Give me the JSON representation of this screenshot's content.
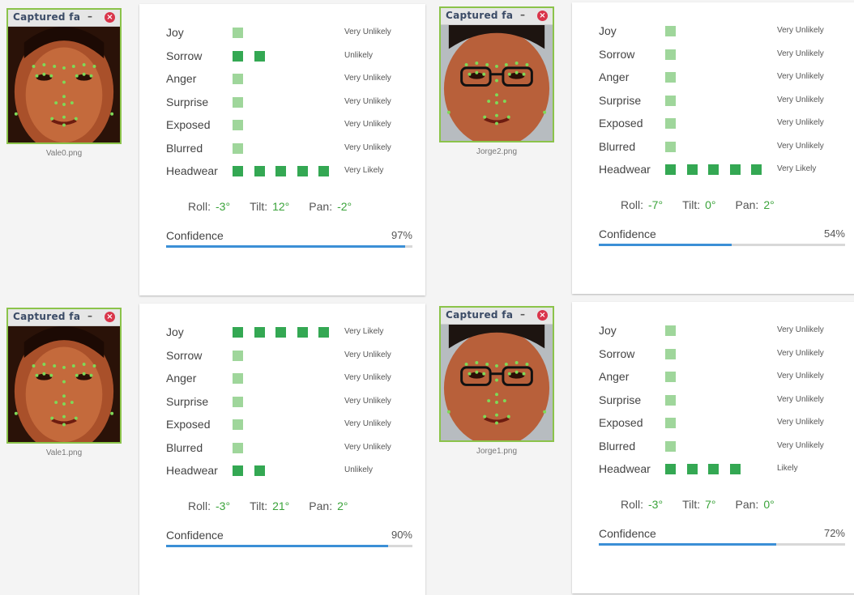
{
  "panels": [
    {
      "window_title": "Captured fa",
      "filename": "Vale0.png",
      "face_style": "female",
      "rows": [
        {
          "label": "Joy",
          "level": 1,
          "value": "Very Unlikely"
        },
        {
          "label": "Sorrow",
          "level": 2,
          "value": "Unlikely"
        },
        {
          "label": "Anger",
          "level": 1,
          "value": "Very Unlikely"
        },
        {
          "label": "Surprise",
          "level": 1,
          "value": "Very Unlikely"
        },
        {
          "label": "Exposed",
          "level": 1,
          "value": "Very Unlikely"
        },
        {
          "label": "Blurred",
          "level": 1,
          "value": "Very Unlikely"
        },
        {
          "label": "Headwear",
          "level": 5,
          "value": "Very Likely"
        }
      ],
      "roll_label": "Roll:",
      "roll": "-3°",
      "tilt_label": "Tilt:",
      "tilt": "12°",
      "pan_label": "Pan:",
      "pan": "-2°",
      "confidence_label": "Confidence",
      "confidence": "97%",
      "confidence_fraction": 0.97
    },
    {
      "window_title": "Captured fa",
      "filename": "Jorge2.png",
      "face_style": "male",
      "rows": [
        {
          "label": "Joy",
          "level": 1,
          "value": "Very Unlikely"
        },
        {
          "label": "Sorrow",
          "level": 1,
          "value": "Very Unlikely"
        },
        {
          "label": "Anger",
          "level": 1,
          "value": "Very Unlikely"
        },
        {
          "label": "Surprise",
          "level": 1,
          "value": "Very Unlikely"
        },
        {
          "label": "Exposed",
          "level": 1,
          "value": "Very Unlikely"
        },
        {
          "label": "Blurred",
          "level": 1,
          "value": "Very Unlikely"
        },
        {
          "label": "Headwear",
          "level": 5,
          "value": "Very Likely"
        }
      ],
      "roll_label": "Roll:",
      "roll": "-7°",
      "tilt_label": "Tilt:",
      "tilt": "0°",
      "pan_label": "Pan:",
      "pan": "2°",
      "confidence_label": "Confidence",
      "confidence": "54%",
      "confidence_fraction": 0.54
    },
    {
      "window_title": "Captured fa",
      "filename": "Vale1.png",
      "face_style": "female",
      "rows": [
        {
          "label": "Joy",
          "level": 5,
          "value": "Very Likely"
        },
        {
          "label": "Sorrow",
          "level": 1,
          "value": "Very Unlikely"
        },
        {
          "label": "Anger",
          "level": 1,
          "value": "Very Unlikely"
        },
        {
          "label": "Surprise",
          "level": 1,
          "value": "Very Unlikely"
        },
        {
          "label": "Exposed",
          "level": 1,
          "value": "Very Unlikely"
        },
        {
          "label": "Blurred",
          "level": 1,
          "value": "Very Unlikely"
        },
        {
          "label": "Headwear",
          "level": 2,
          "value": "Unlikely"
        }
      ],
      "roll_label": "Roll:",
      "roll": "-3°",
      "tilt_label": "Tilt:",
      "tilt": "21°",
      "pan_label": "Pan:",
      "pan": "2°",
      "confidence_label": "Confidence",
      "confidence": "90%",
      "confidence_fraction": 0.9
    },
    {
      "window_title": "Captured fa",
      "filename": "Jorge1.png",
      "face_style": "male",
      "rows": [
        {
          "label": "Joy",
          "level": 1,
          "value": "Very Unlikely"
        },
        {
          "label": "Sorrow",
          "level": 1,
          "value": "Very Unlikely"
        },
        {
          "label": "Anger",
          "level": 1,
          "value": "Very Unlikely"
        },
        {
          "label": "Surprise",
          "level": 1,
          "value": "Very Unlikely"
        },
        {
          "label": "Exposed",
          "level": 1,
          "value": "Very Unlikely"
        },
        {
          "label": "Blurred",
          "level": 1,
          "value": "Very Unlikely"
        },
        {
          "label": "Headwear",
          "level": 4,
          "value": "Likely"
        }
      ],
      "roll_label": "Roll:",
      "roll": "-3°",
      "tilt_label": "Tilt:",
      "tilt": "7°",
      "pan_label": "Pan:",
      "pan": "0°",
      "confidence_label": "Confidence",
      "confidence": "72%",
      "confidence_fraction": 0.72
    }
  ],
  "colors": {
    "dot_active": "#34a853",
    "dot_inactive": "#9fd69b",
    "angle_value": "#3aa33a",
    "confidence_bar": "#3b8fd6",
    "window_border": "#8bc34a",
    "close_button": "#d9354a"
  },
  "icons": {
    "minimize": "minimize-icon",
    "close": "close-icon"
  }
}
